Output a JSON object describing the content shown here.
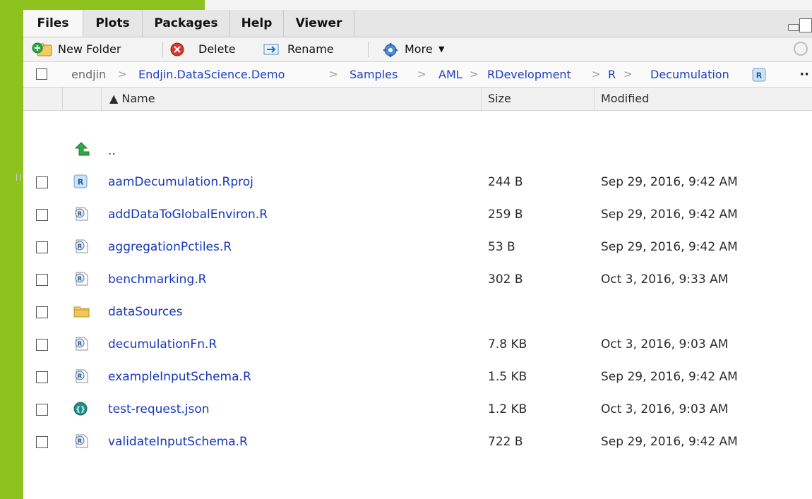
{
  "tabs": [
    {
      "label": "Files",
      "active": true
    },
    {
      "label": "Plots"
    },
    {
      "label": "Packages"
    },
    {
      "label": "Help"
    },
    {
      "label": "Viewer"
    }
  ],
  "toolbar": {
    "new_folder_label": "New Folder",
    "delete_label": "Delete",
    "rename_label": "Rename",
    "more_label": "More"
  },
  "breadcrumb": {
    "segments": [
      "endjin",
      "Endjin.DataScience.Demo",
      "Samples",
      "AML",
      "RDevelopment",
      "R",
      "Decumulation"
    ],
    "overflow": "··"
  },
  "header": {
    "name": "▲ Name",
    "size": "Size",
    "modified": "Modified"
  },
  "files": [
    {
      "name": "..",
      "size": "",
      "modified": "",
      "icon": "up-arrow-icon"
    },
    {
      "name": "aamDecumulation.Rproj",
      "size": "244 B",
      "modified": "Sep 29, 2016, 9:42 AM",
      "icon": "rproj-file-icon"
    },
    {
      "name": "addDataToGlobalEnviron.R",
      "size": "259 B",
      "modified": "Sep 29, 2016, 9:42 AM",
      "icon": "r-file-icon"
    },
    {
      "name": "aggregationPctiles.R",
      "size": "53 B",
      "modified": "Sep 29, 2016, 9:42 AM",
      "icon": "r-file-icon"
    },
    {
      "name": "benchmarking.R",
      "size": "302 B",
      "modified": "Oct 3, 2016, 9:33 AM",
      "icon": "r-file-icon"
    },
    {
      "name": "dataSources",
      "size": "",
      "modified": "",
      "icon": "folder-icon"
    },
    {
      "name": "decumulationFn.R",
      "size": "7.8 KB",
      "modified": "Oct 3, 2016, 9:03 AM",
      "icon": "r-file-icon"
    },
    {
      "name": "exampleInputSchema.R",
      "size": "1.5 KB",
      "modified": "Sep 29, 2016, 9:42 AM",
      "icon": "r-file-icon"
    },
    {
      "name": "test-request.json",
      "size": "1.2 KB",
      "modified": "Oct 3, 2016, 9:03 AM",
      "icon": "json-file-icon"
    },
    {
      "name": "validateInputSchema.R",
      "size": "722 B",
      "modified": "Sep 29, 2016, 9:42 AM",
      "icon": "r-file-icon"
    }
  ],
  "colors": {
    "accent_green": "#8dc21f",
    "link_blue": "#1737b7"
  }
}
